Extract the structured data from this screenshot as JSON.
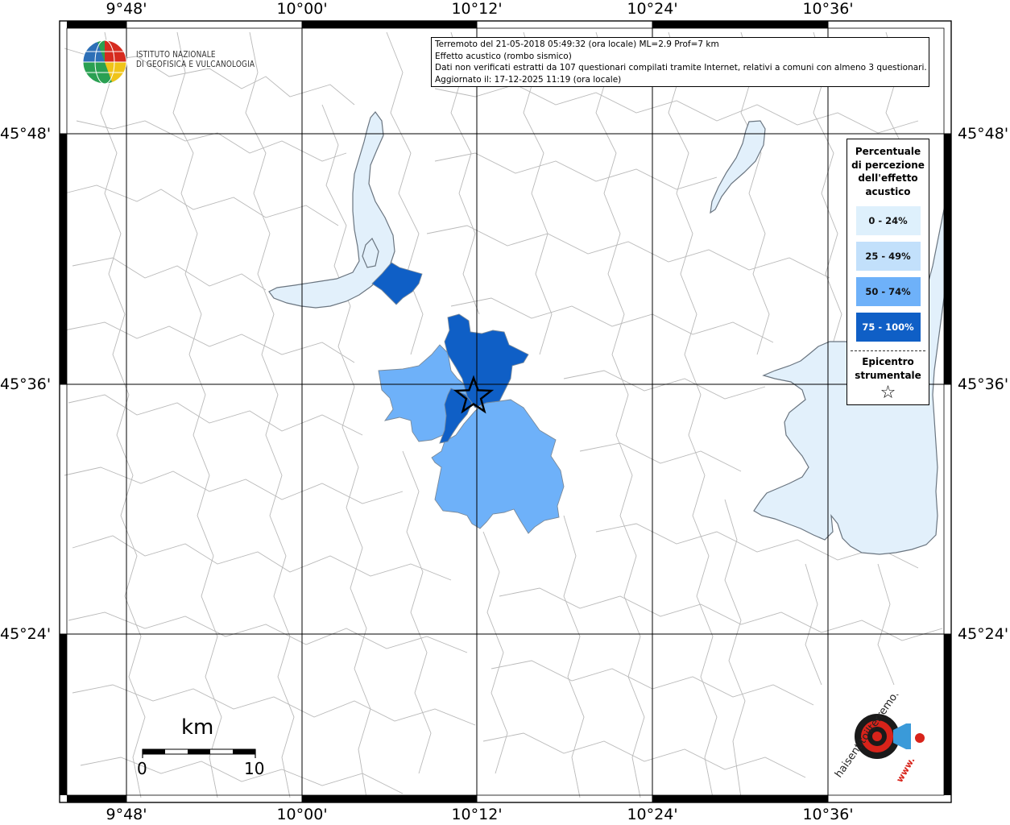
{
  "header": {
    "logo_text": [
      "ISTITUTO NAZIONALE",
      "DI GEOFISICA E VULCANOLOGIA"
    ],
    "info_lines": [
      "Terremoto del 21-05-2018 05:49:32 (ora locale) ML=2.9 Prof=7 km",
      "Effetto acustico (rombo sismico)",
      "Dati non verificati estratti da 107 questionari compilati tramite Internet, relativi a comuni con almeno 3 questionari.",
      "Aggiornato il: 17-12-2025 11:19 (ora locale)"
    ]
  },
  "axes": {
    "longitudes": [
      "9°48'",
      "10°00'",
      "10°12'",
      "10°24'",
      "10°36'"
    ],
    "latitudes": [
      "45°48'",
      "45°36'",
      "45°24'"
    ]
  },
  "legend": {
    "title": [
      "Percentuale",
      "di percezione",
      "dell'effetto",
      "acustico"
    ],
    "classes": [
      {
        "label": "0 - 24%",
        "color": "#def0fc"
      },
      {
        "label": "25 - 49%",
        "color": "#c2e0fb"
      },
      {
        "label": "50 - 74%",
        "color": "#6eb1f9"
      },
      {
        "label": "75 - 100%",
        "color": "#0f5fc6"
      }
    ],
    "epicenter_label": [
      "Epicentro",
      "strumentale"
    ],
    "epicenter_symbol": "☆"
  },
  "scale_bar": {
    "unit": "km",
    "start": "0",
    "end": "10"
  },
  "watermark": {
    "text": "haisentitoilterremoto.it",
    "url": "www."
  },
  "colors": {
    "lake": "#e2f0fb",
    "low": "#def0fc",
    "mid_low": "#c2e0fb",
    "mid_high": "#6eb1f9",
    "high": "#0f5fc6",
    "boundary": "#b7b7b7"
  }
}
